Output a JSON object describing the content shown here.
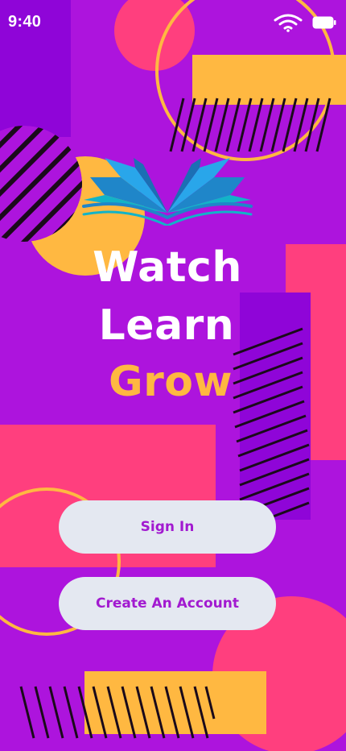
{
  "status_bar": {
    "time": "9:40",
    "icons": [
      "wifi-icon",
      "battery-icon"
    ]
  },
  "logo": {
    "icon": "open-book-icon"
  },
  "hero": {
    "line1": "Watch",
    "line2": "Learn",
    "line3": "Grow"
  },
  "actions": {
    "sign_in_label": "Sign In",
    "create_account_label": "Create An Account"
  },
  "colors": {
    "background": "#ad14dd",
    "accent_yellow": "#ffb841",
    "accent_pink": "#ff3f7e",
    "accent_deep_purple": "#8f05d8",
    "button_bg": "#e4e8f1",
    "button_text": "#a21ad0"
  }
}
